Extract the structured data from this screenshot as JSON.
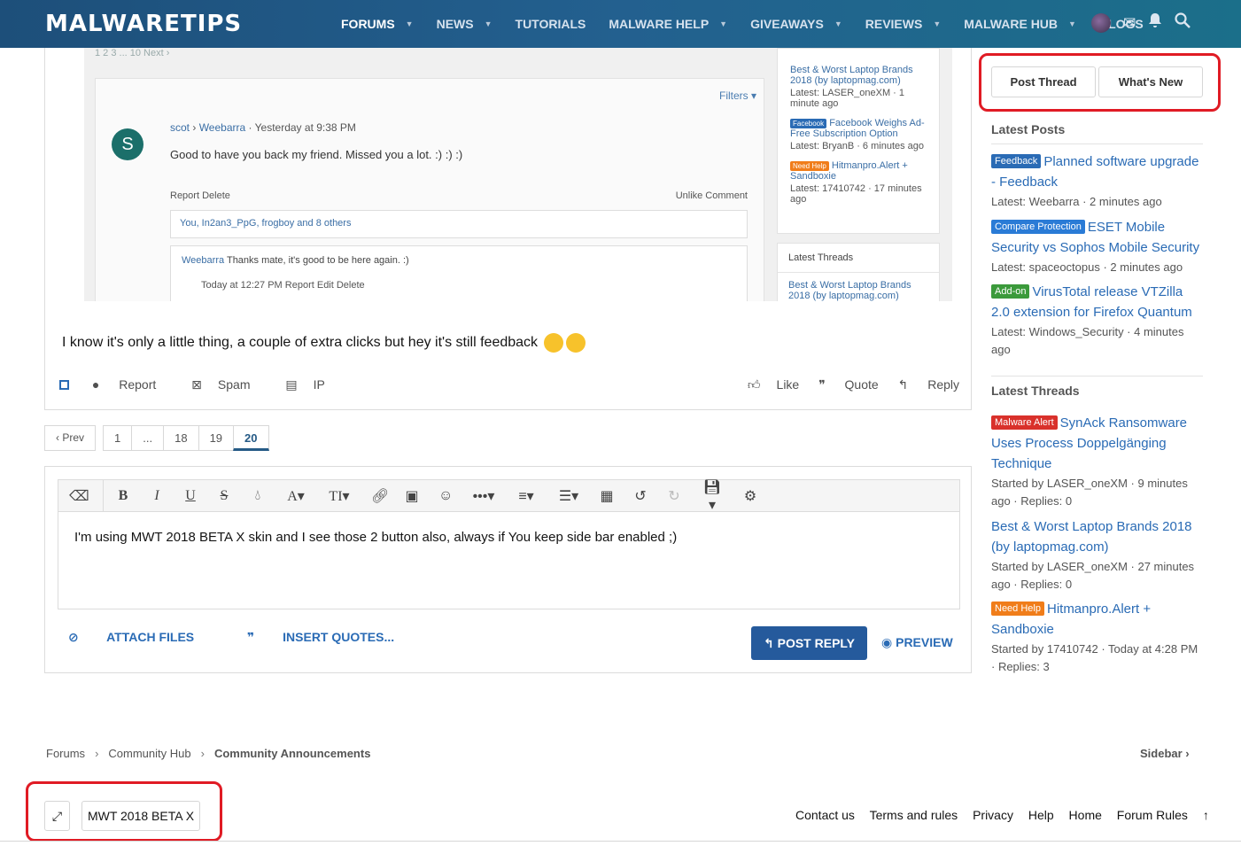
{
  "header": {
    "logo": "MALWARETIPS",
    "nav": [
      {
        "label": "FORUMS",
        "caret": true
      },
      {
        "label": "NEWS",
        "caret": true
      },
      {
        "label": "TUTORIALS",
        "caret": false
      },
      {
        "label": "MALWARE HELP",
        "caret": true
      },
      {
        "label": "GIVEAWAYS",
        "caret": true
      },
      {
        "label": "REVIEWS",
        "caret": true
      },
      {
        "label": "MALWARE HUB",
        "caret": true
      },
      {
        "label": "BLOGS",
        "caret": false
      }
    ]
  },
  "embedded_screenshot": {
    "pager": "1  2  3  ...  10    Next ›",
    "filters": "Filters ▾",
    "avatar_letter": "S",
    "meta_user": "scot",
    "meta_to": "Weebarra",
    "meta_time": "· Yesterday at 9:38 PM",
    "message": "Good to have you back my friend. Missed you a lot. :) :) :)",
    "actions_left": "Report    Delete",
    "actions_right": "Unlike    Comment",
    "likes": "You, In2an3_PpG, frogboy and 8 others",
    "reply_user": "Weebarra",
    "reply_text": "Thanks mate, it's good to be here again. :)",
    "reply_time": "Today at 12:27 PM    Report    Edit    Delete",
    "side_items": [
      {
        "title": "Best & Worst Laptop Brands 2018 (by laptopmag.com)",
        "sub": "Latest: LASER_oneXM · 1 minute ago"
      },
      {
        "tag": "Facebook",
        "title": "Facebook Weighs Ad-Free Subscription Option",
        "sub": "Latest: BryanB · 6 minutes ago"
      },
      {
        "tag": "Need Help",
        "title": "Hitmanpro.Alert + Sandboxie",
        "sub": "Latest: 17410742 · 17 minutes ago"
      }
    ],
    "latest_threads_heading": "Latest Threads",
    "latest_threads_item": "Best & Worst Laptop Brands 2018 (by laptopmag.com)"
  },
  "post": {
    "text": "I know it's only a little thing, a couple of extra clicks but hey it's still feedback",
    "actions_left": [
      "Report",
      "Spam",
      "IP"
    ],
    "actions_right": [
      "Like",
      "Quote",
      "Reply"
    ]
  },
  "pagination": {
    "prev": "‹ Prev",
    "pages": [
      "1",
      "...",
      "18",
      "19",
      "20"
    ],
    "current": "20"
  },
  "editor": {
    "content": "I'm using MWT 2018 BETA X skin and I see those 2 button also, always if You keep side bar enabled ;)",
    "attach": "ATTACH FILES",
    "insert_quotes": "INSERT QUOTES...",
    "post_reply": "POST REPLY",
    "preview": "PREVIEW"
  },
  "sidebar": {
    "post_thread": "Post Thread",
    "whats_new": "What's New",
    "latest_posts_heading": "Latest Posts",
    "latest_posts": [
      {
        "tag": "Feedback",
        "tag_color": "#2a6bb5",
        "title": "Planned software upgrade - Feedback",
        "sub": "Latest: Weebarra · 2 minutes ago"
      },
      {
        "tag": "Compare Protection",
        "tag_color": "#2a7bd6",
        "title": "ESET Mobile Security vs Sophos Mobile Security",
        "sub": "Latest: spaceoctopus · 2 minutes ago"
      },
      {
        "tag": "Add-on",
        "tag_color": "#3b9a3b",
        "title": "VirusTotal release VTZilla 2.0 extension for Firefox Quantum",
        "sub": "Latest: Windows_Security · 4 minutes ago"
      }
    ],
    "latest_threads_heading": "Latest Threads",
    "latest_threads": [
      {
        "tag": "Malware Alert",
        "tag_color": "#d9312b",
        "title": "SynAck Ransomware Uses Process Doppelgänging Technique",
        "sub": "Started by LASER_oneXM · 9 minutes ago · Replies: 0"
      },
      {
        "tag": "",
        "tag_color": "",
        "title": "Best & Worst Laptop Brands 2018 (by laptopmag.com)",
        "sub": "Started by LASER_oneXM · 27 minutes ago · Replies: 0"
      },
      {
        "tag": "Need Help",
        "tag_color": "#f07d1a",
        "title": "Hitmanpro.Alert + Sandboxie",
        "sub": "Started by 17410742 · Today at 4:28 PM · Replies: 3"
      }
    ]
  },
  "breadcrumb": {
    "items": [
      "Forums",
      "Community Hub",
      "Community Announcements"
    ],
    "sidebar_link": "Sidebar ›"
  },
  "footer": {
    "style_name": "MWT 2018 BETA X",
    "links": [
      "Contact us",
      "Terms and rules",
      "Privacy",
      "Help",
      "Home",
      "Forum Rules"
    ]
  }
}
